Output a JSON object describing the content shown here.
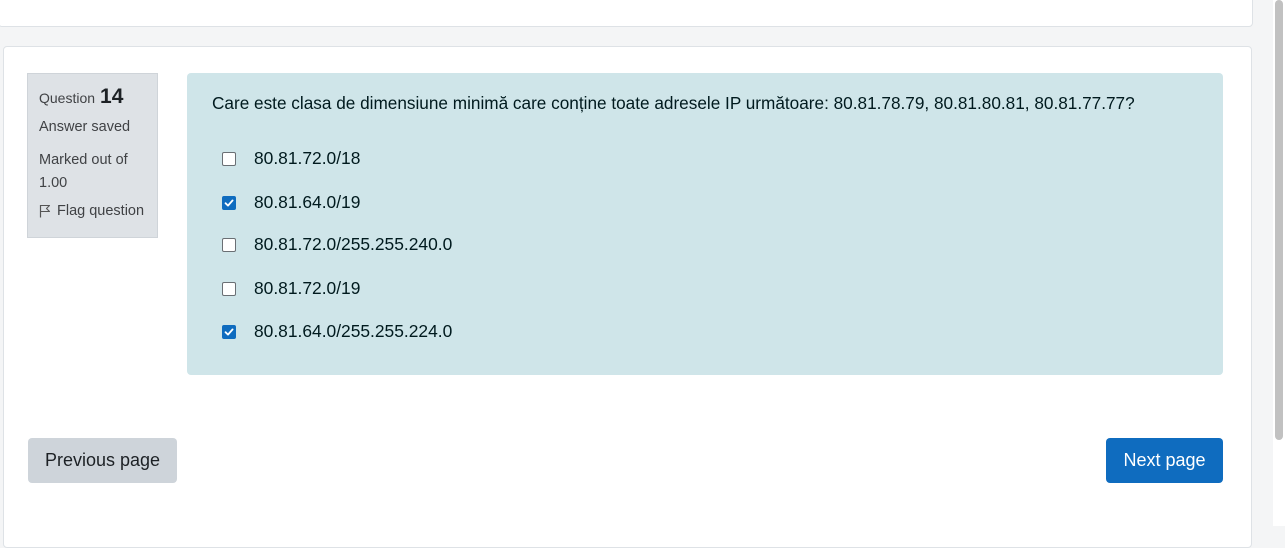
{
  "question_info": {
    "question_label": "Question",
    "question_number": "14",
    "state": "Answer saved",
    "grade": "Marked out of 1.00",
    "flag_label": "Flag question"
  },
  "question": {
    "text": "Care este clasa de dimensiune minimă care conține toate adresele IP următoare: 80.81.78.79, 80.81.80.81, 80.81.77.77?",
    "options": [
      {
        "label": "80.81.72.0/18",
        "checked": false
      },
      {
        "label": "80.81.64.0/19",
        "checked": true
      },
      {
        "label": "80.81.72.0/255.255.240.0",
        "checked": false
      },
      {
        "label": "80.81.72.0/19",
        "checked": false
      },
      {
        "label": "80.81.64.0/255.255.224.0",
        "checked": true
      }
    ]
  },
  "navigation": {
    "previous_label": "Previous page",
    "next_label": "Next page"
  },
  "colors": {
    "accent": "#0f6cbf",
    "question_bg": "#cfe5e9",
    "info_bg": "#dee2e6"
  }
}
